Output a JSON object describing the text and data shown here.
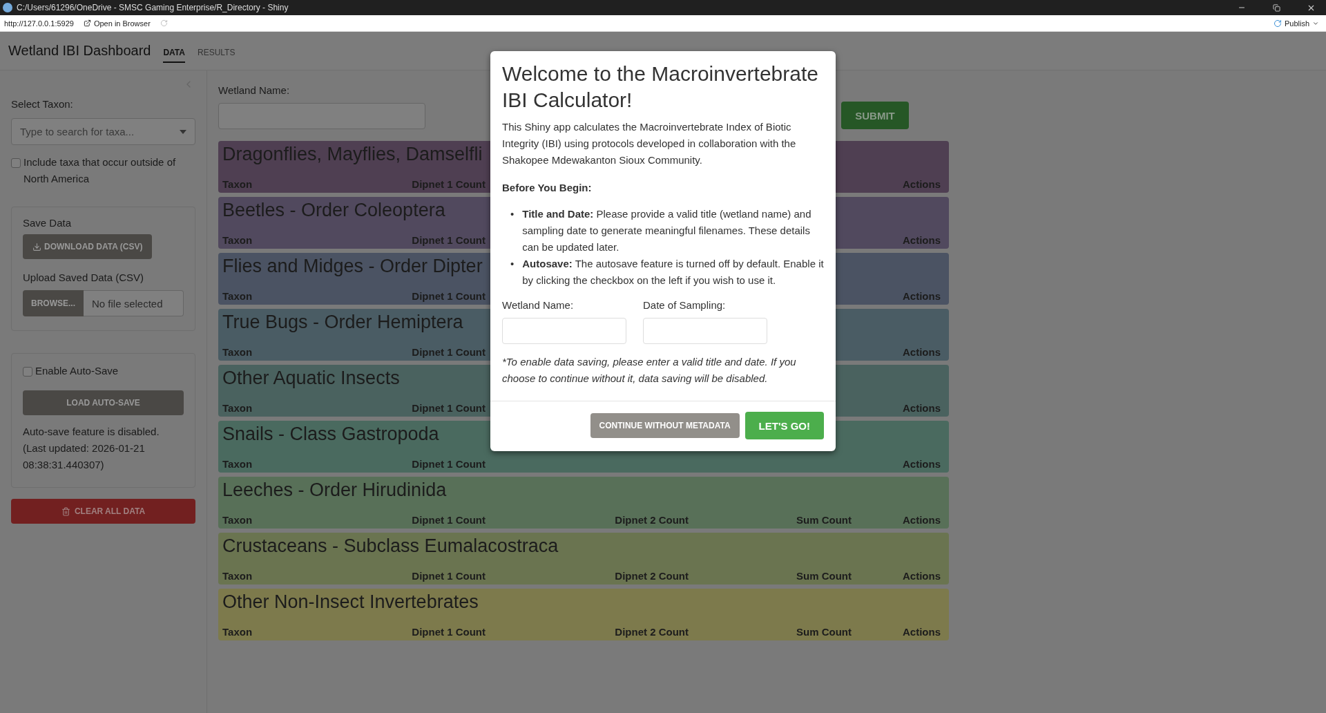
{
  "window": {
    "title": "C:/Users/61296/OneDrive - SMSC Gaming Enterprise/R_Directory - Shiny"
  },
  "address_bar": {
    "url": "http://127.0.0.1:5929",
    "open_button": "Open in Browser",
    "publish_button": "Publish"
  },
  "navbar": {
    "title": "Wetland IBI Dashboard",
    "tabs": [
      {
        "label": "DATA",
        "selected": true
      },
      {
        "label": "RESULTS",
        "selected": false
      }
    ]
  },
  "sidebar": {
    "taxon_label": "Select Taxon:",
    "taxon_placeholder": "Type to search for taxa...",
    "include_outside": {
      "label": "Include taxa that occur outside of North America",
      "checked": false
    },
    "save_panel": {
      "title": "Save Data",
      "download_button": "DOWNLOAD DATA (CSV)",
      "upload_label": "Upload Saved Data (CSV)",
      "browse_button": "BROWSE...",
      "file_status": "No file selected"
    },
    "autosave_panel": {
      "checkbox": {
        "label": "Enable Auto-Save",
        "checked": false
      },
      "load_button": "LOAD AUTO-SAVE",
      "status": "Auto-save feature is disabled.",
      "last_updated": "(Last updated: 2026-01-21 08:38:31.440307)"
    },
    "clear_button": "CLEAR ALL DATA"
  },
  "main": {
    "wetland_label": "Wetland Name:",
    "submit_button": "SUBMIT",
    "sections": [
      {
        "title": "Dragonflies, Mayflies, Damselfli",
        "color": "#4f3f52",
        "columns": [
          {
            "kind": "taxon",
            "label": "Taxon"
          },
          {
            "kind": "dipnet1",
            "label": "Dipnet 1 Count"
          },
          {
            "kind": "actions",
            "label": "Actions"
          }
        ]
      },
      {
        "title": "Beetles - Order Coleoptera",
        "color": "#51495e",
        "columns": [
          {
            "kind": "taxon",
            "label": "Taxon"
          },
          {
            "kind": "dipnet1",
            "label": "Dipnet 1 Count"
          },
          {
            "kind": "actions",
            "label": "Actions"
          }
        ]
      },
      {
        "title": "Flies and Midges - Order Dipter",
        "color": "#4b5363",
        "columns": [
          {
            "kind": "taxon",
            "label": "Taxon"
          },
          {
            "kind": "dipnet1",
            "label": "Dipnet 1 Count"
          },
          {
            "kind": "actions",
            "label": "Actions"
          }
        ]
      },
      {
        "title": "True Bugs - Order Hemiptera",
        "color": "#4a5c64",
        "columns": [
          {
            "kind": "taxon",
            "label": "Taxon"
          },
          {
            "kind": "dipnet1",
            "label": "Dipnet 1 Count"
          },
          {
            "kind": "actions",
            "label": "Actions"
          }
        ]
      },
      {
        "title": "Other Aquatic Insects",
        "color": "#4a625f",
        "columns": [
          {
            "kind": "taxon",
            "label": "Taxon"
          },
          {
            "kind": "dipnet1",
            "label": "Dipnet 1 Count"
          },
          {
            "kind": "actions",
            "label": "Actions"
          }
        ]
      },
      {
        "title": "Snails - Class Gastropoda",
        "color": "#4a6a5f",
        "columns": [
          {
            "kind": "taxon",
            "label": "Taxon"
          },
          {
            "kind": "dipnet1",
            "label": "Dipnet 1 Count"
          },
          {
            "kind": "actions",
            "label": "Actions"
          }
        ]
      },
      {
        "title": "Leeches - Order Hirudinida",
        "color": "#587058",
        "columns": [
          {
            "kind": "taxon",
            "label": "Taxon"
          },
          {
            "kind": "dipnet1",
            "label": "Dipnet 1 Count"
          },
          {
            "kind": "dipnet2",
            "label": "Dipnet 2 Count"
          },
          {
            "kind": "sum",
            "label": "Sum Count"
          },
          {
            "kind": "actions",
            "label": "Actions"
          }
        ]
      },
      {
        "title": "Crustaceans - Subclass Eumalacostraca",
        "color": "#6a7450",
        "columns": [
          {
            "kind": "taxon",
            "label": "Taxon"
          },
          {
            "kind": "dipnet1",
            "label": "Dipnet 1 Count"
          },
          {
            "kind": "dipnet2",
            "label": "Dipnet 2 Count"
          },
          {
            "kind": "sum",
            "label": "Sum Count"
          },
          {
            "kind": "actions",
            "label": "Actions"
          }
        ]
      },
      {
        "title": "Other Non-Insect Invertebrates",
        "color": "#7d7a4c",
        "columns": [
          {
            "kind": "taxon",
            "label": "Taxon"
          },
          {
            "kind": "dipnet1",
            "label": "Dipnet 1 Count"
          },
          {
            "kind": "dipnet2",
            "label": "Dipnet 2 Count"
          },
          {
            "kind": "sum",
            "label": "Sum Count"
          },
          {
            "kind": "actions",
            "label": "Actions"
          }
        ]
      }
    ]
  },
  "modal": {
    "title": "Welcome to the Macroinvertebrate IBI Calculator!",
    "intro": "This Shiny app calculates the Macroinvertebrate Index of Biotic Integrity (IBI) using protocols developed in collaboration with the Shakopee Mdewakanton Sioux Community.",
    "subheading": "Before You Begin:",
    "bullets": [
      {
        "marker": "•",
        "text": "**Title and Date:** Please provide a valid title (wetland name) and sampling date to generate meaningful filenames. These details can be updated later."
      },
      {
        "marker": "•",
        "text": "**Autosave:** The autosave feature is turned off by default. Enable it by clicking the checkbox on the left if you wish to use it."
      }
    ],
    "fields": [
      {
        "label": "Wetland Name:"
      },
      {
        "label": "Date of Sampling:"
      }
    ],
    "note": "*To enable data saving, please enter a valid title and date. If you choose to continue without it, data saving will be disabled.",
    "buttons": [
      {
        "label": "CONTINUE WITHOUT METADATA",
        "kind": "secondary"
      },
      {
        "label": "LET'S GO!",
        "kind": "primary"
      }
    ]
  }
}
